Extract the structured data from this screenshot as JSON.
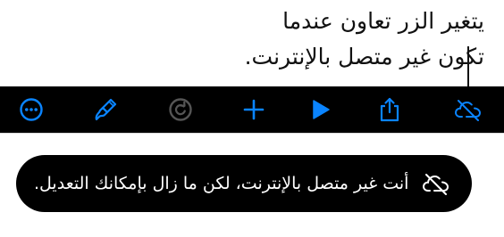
{
  "callout": {
    "line1": "يتغير الزر تعاون عندما",
    "line2": "تكون غير متصل بالإنترنت."
  },
  "toolbar": {
    "items": [
      {
        "name": "more-icon"
      },
      {
        "name": "paintbrush-icon"
      },
      {
        "name": "redo-icon"
      },
      {
        "name": "add-icon"
      },
      {
        "name": "play-icon"
      },
      {
        "name": "share-icon"
      },
      {
        "name": "cloud-offline-icon"
      }
    ],
    "accent": "#0a84ff",
    "disabled": "#555555"
  },
  "banner": {
    "text": "أنت غير متصل بالإنترنت، لكن ما زال بإمكانك التعديل.",
    "icon": "cloud-offline-icon"
  }
}
